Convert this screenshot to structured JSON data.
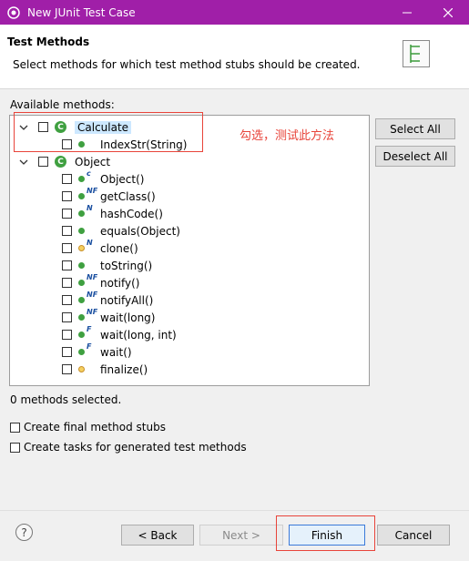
{
  "window": {
    "title": "New JUnit Test Case",
    "titlebar_color": "#a01fa8"
  },
  "header": {
    "title": "Test Methods",
    "description": "Select methods for which test method stubs should be created."
  },
  "available_label": "Available methods:",
  "tree": {
    "nodes": [
      {
        "label": "Calculate",
        "kind": "class",
        "icon": "class-icon",
        "expanded": true,
        "checked": false,
        "selected": true
      },
      {
        "label": "IndexStr(String)",
        "kind": "method",
        "icon": "public-method-icon",
        "checked": false
      },
      {
        "label": "Object",
        "kind": "class",
        "icon": "class-icon",
        "expanded": true,
        "checked": false
      },
      {
        "label": "Object()",
        "modifier": "c",
        "icon": "constructor-icon",
        "checked": false
      },
      {
        "label": "getClass()",
        "modifier": "NF",
        "icon": "native-final-method-icon",
        "checked": false
      },
      {
        "label": "hashCode()",
        "modifier": "N",
        "icon": "native-method-icon",
        "checked": false
      },
      {
        "label": "equals(Object)",
        "modifier": "",
        "icon": "public-method-icon",
        "checked": false
      },
      {
        "label": "clone()",
        "modifier": "N",
        "icon": "protected-native-method-icon",
        "checked": false
      },
      {
        "label": "toString()",
        "modifier": "",
        "icon": "public-method-icon",
        "checked": false
      },
      {
        "label": "notify()",
        "modifier": "NF",
        "icon": "native-final-method-icon",
        "checked": false
      },
      {
        "label": "notifyAll()",
        "modifier": "NF",
        "icon": "native-final-method-icon",
        "checked": false
      },
      {
        "label": "wait(long)",
        "modifier": "NF",
        "icon": "native-final-method-icon",
        "checked": false
      },
      {
        "label": "wait(long, int)",
        "modifier": "F",
        "icon": "final-method-icon",
        "checked": false
      },
      {
        "label": "wait()",
        "modifier": "F",
        "icon": "final-method-icon",
        "checked": false
      },
      {
        "label": "finalize()",
        "modifier": "",
        "icon": "protected-method-icon",
        "checked": false
      }
    ]
  },
  "annotation": {
    "text": "勾选，测试此方法",
    "color": "#e8443a"
  },
  "side_buttons": {
    "select_all": "Select All",
    "deselect_all": "Deselect All"
  },
  "status": "0 methods selected.",
  "options": {
    "final_stubs": "Create final method stubs",
    "tasks": "Create tasks for generated test methods"
  },
  "footer": {
    "help": "?",
    "back": "< Back",
    "next": "Next >",
    "finish": "Finish",
    "cancel": "Cancel"
  }
}
